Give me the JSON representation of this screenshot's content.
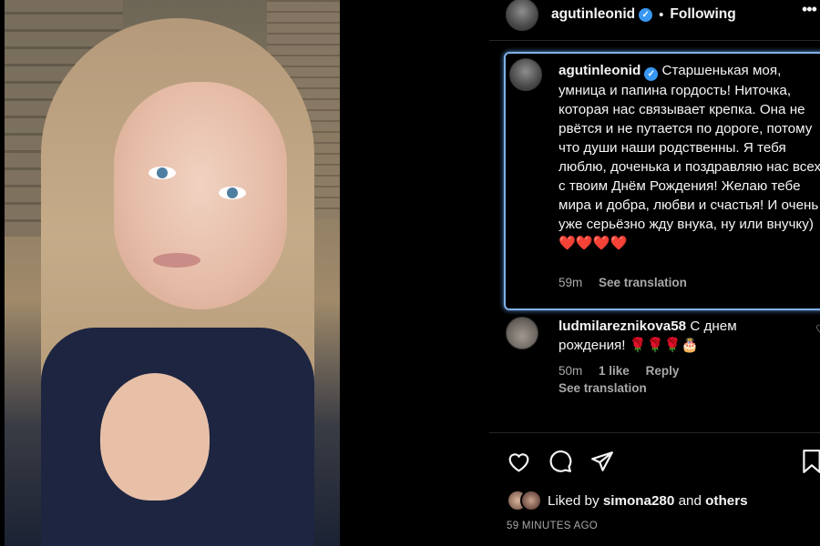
{
  "post": {
    "author": "agutinleonid",
    "follow_status": "Following",
    "dot": "•",
    "more": "•••",
    "verified_mark": "✓"
  },
  "caption": {
    "username": "agutinleonid",
    "text": "Старшенькая моя, умница и папина гордость! Ниточка, которая нас связывает крепка. Она не рвётся и не путается по дороге, потому что души наши родственны. Я тебя люблю, доченька и поздравляю нас всех с твоим Днём Рождения! Желаю тебе мира и добра, любви и счастья! И очень уже серьёзно жду внука, ну или внучку)",
    "emoji": "❤️❤️❤️❤️",
    "time": "59m",
    "translate": "See translation"
  },
  "comment": {
    "username": "ludmilareznikova58",
    "text": "С днем рождения!",
    "emoji": "🌹🌹🌹🎂",
    "time": "50m",
    "likes": "1 like",
    "reply": "Reply",
    "translate": "See translation",
    "heart": "♡"
  },
  "likes": {
    "prefix": "Liked by",
    "user": "simona280",
    "and": "and",
    "others": "others"
  },
  "timestamp": "59 MINUTES AGO",
  "icons": [
    "heart-icon",
    "comment-icon",
    "share-icon",
    "bookmark-icon",
    "verified-icon",
    "more-icon"
  ],
  "colors": {
    "background": "#000000",
    "text": "#f5f5f5",
    "muted": "#a8a8a8",
    "verified": "#3897f0",
    "highlight_border": "#7fb0e8"
  }
}
